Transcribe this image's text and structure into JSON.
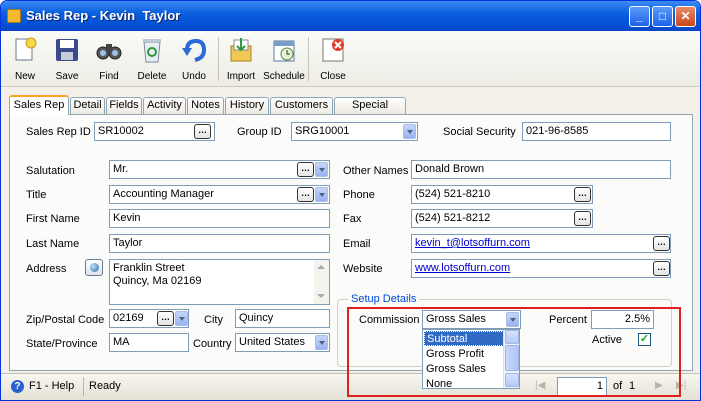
{
  "window": {
    "title": "Sales Rep - Kevin  Taylor",
    "minimize": "_",
    "maximize": "□",
    "close": "✕"
  },
  "toolbar": {
    "new": "New",
    "save": "Save",
    "find": "Find",
    "delete": "Delete",
    "undo": "Undo",
    "import": "Import",
    "schedule": "Schedule",
    "close": "Close"
  },
  "tabs": [
    "Sales Rep",
    "Detail",
    "Fields",
    "Activity",
    "Notes",
    "History",
    "Customers",
    "Special Pricing"
  ],
  "header": {
    "sales_rep_id_label": "Sales Rep ID",
    "sales_rep_id": "SR10002",
    "group_id_label": "Group ID",
    "group_id": "SRG10001",
    "ssn_label": "Social Security",
    "ssn": "021-96-8585"
  },
  "left": {
    "salutation_label": "Salutation",
    "salutation": "Mr.",
    "title_label": "Title",
    "title": "Accounting Manager",
    "first_name_label": "First Name",
    "first_name": "Kevin",
    "last_name_label": "Last Name",
    "last_name": "Taylor",
    "address_label": "Address",
    "address_line1": "Franklin Street",
    "address_line2": "Quincy, Ma 02169",
    "zip_label": "Zip/Postal Code",
    "zip": "02169",
    "city_label": "City",
    "city": "Quincy",
    "state_label": "State/Province",
    "state": "MA",
    "country_label": "Country",
    "country": "United States"
  },
  "right": {
    "other_names_label": "Other Names",
    "other_names": "Donald Brown",
    "phone_label": "Phone",
    "phone": "(524) 521-8210",
    "fax_label": "Fax",
    "fax": "(524) 521-8212",
    "email_label": "Email",
    "email": "kevin_t@lotsoffurn.com",
    "website_label": "Website",
    "website": "www.lotsoffurn.com"
  },
  "setup": {
    "title": "Setup Details",
    "commission_label": "Commission",
    "commission": "Gross Sales",
    "percent_label": "Percent",
    "percent": "2.5%",
    "active_label": "Active",
    "active_check": "✓",
    "options": [
      "Subtotal",
      "Gross Profit",
      "Gross Sales",
      "None"
    ]
  },
  "status": {
    "help": "F1 - Help",
    "ready": "Ready",
    "page": "1",
    "of_label": "of",
    "total_pages": "1"
  }
}
